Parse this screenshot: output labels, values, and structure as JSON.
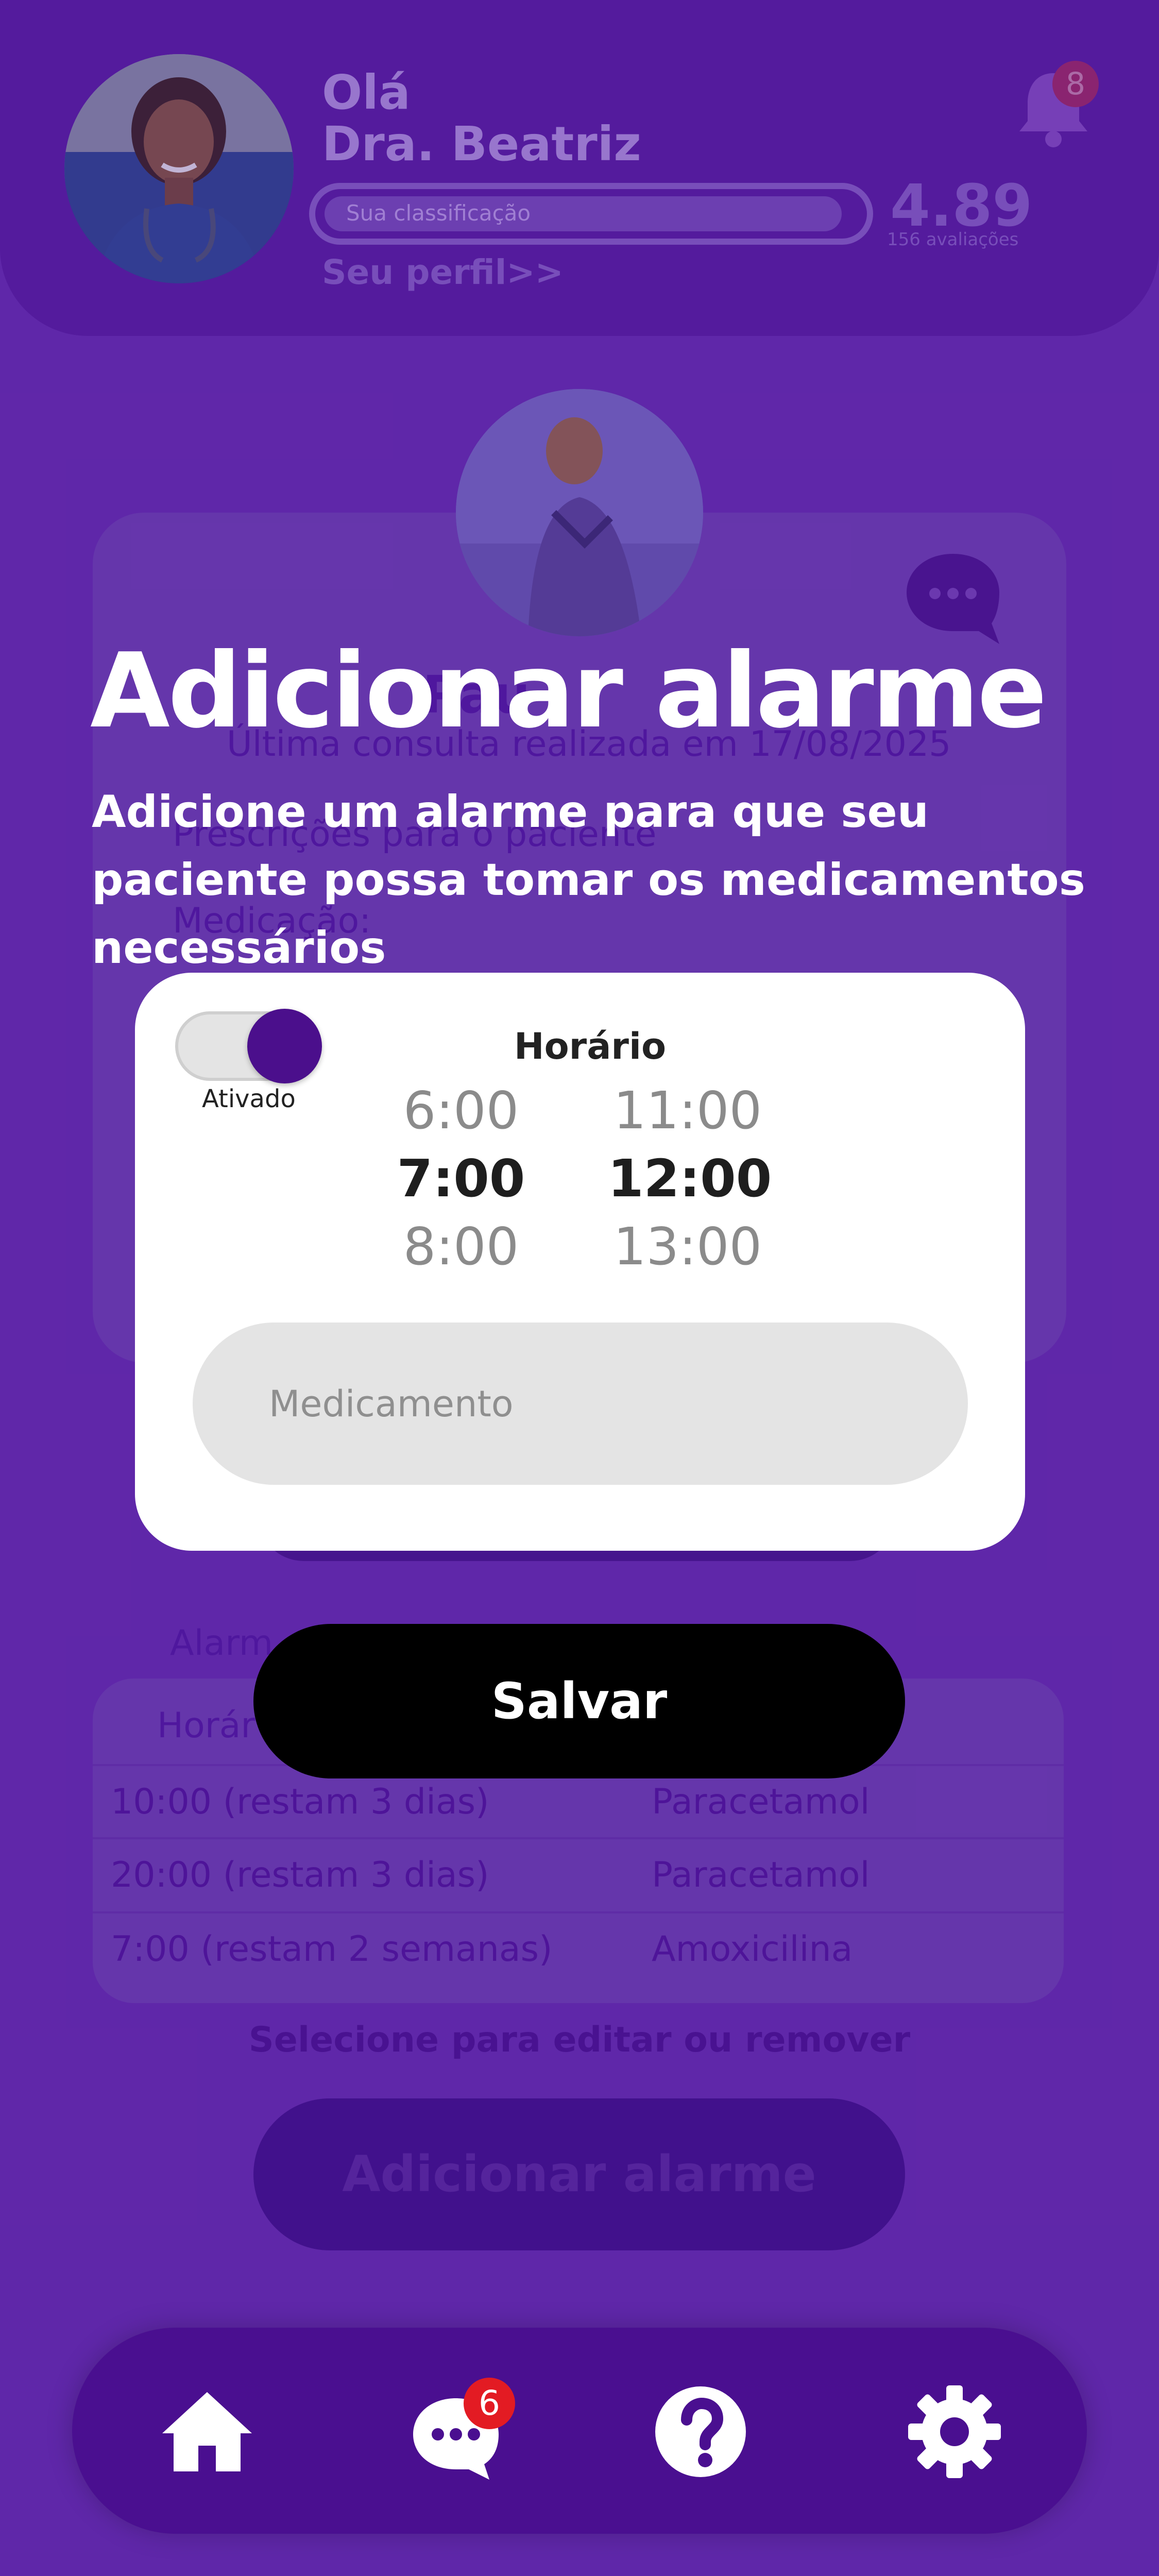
{
  "header": {
    "greeting": "Olá",
    "doctor_name": "Dra. Beatriz",
    "rating_label": "Sua classificação",
    "rating_score": "4.89",
    "rating_progress": 0.97,
    "rating_count": "156 avaliações",
    "profile_link": "Seu perfil>>",
    "notification_count": "8"
  },
  "background": {
    "patient_name_partial": "Pau",
    "last_consult": "Última consulta realizada em 17/08/2025",
    "prescriptions_label": "Prescrições para o paciente",
    "medication_label": "Medicação:",
    "alarms_title": "Alarm",
    "table_header_time": "Horár",
    "rows": [
      {
        "time": "10:00 (restam 3 dias)",
        "medicine": "Paracetamol"
      },
      {
        "time": "20:00 (restam 3 dias)",
        "medicine": "Paracetamol"
      },
      {
        "time": "7:00 (restam 2 semanas)",
        "medicine": "Amoxicilina"
      }
    ],
    "select_hint": "Selecione para editar ou remover",
    "add_alarm_button": "Adicionar alarme"
  },
  "modal": {
    "title": "Adicionar alarme",
    "subtitle": "Adicione um alarme para que seu paciente possa tomar os medicamentos necessários",
    "toggle_label": "Ativado",
    "toggle_on": true,
    "time_label": "Horário",
    "hours": [
      "6:00",
      "7:00",
      "8:00"
    ],
    "minutes": [
      "11:00",
      "12:00",
      "13:00"
    ],
    "selected_hour": "7:00",
    "selected_minute": "12:00",
    "medication_placeholder": "Medicamento",
    "save_button": "Salvar"
  },
  "nav": {
    "items": [
      {
        "name": "home",
        "icon": "home-icon"
      },
      {
        "name": "messages",
        "icon": "chat-icon"
      },
      {
        "name": "help",
        "icon": "help-icon"
      },
      {
        "name": "settings",
        "icon": "gear-icon"
      }
    ],
    "chat_badge": "6"
  },
  "colors": {
    "primary": "#4a0f90",
    "background": "#6a2fb4",
    "save_button": "#000000",
    "badge": "#e31b23"
  }
}
